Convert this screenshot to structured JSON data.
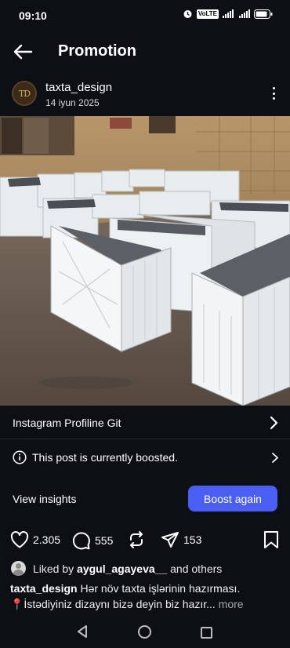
{
  "status_bar": {
    "time": "09:10",
    "volte_badge": "VoLTE",
    "network": "4G",
    "icons": [
      "alarm-icon",
      "volte-icon",
      "signal-icon",
      "signal-4g-icon",
      "battery-icon"
    ]
  },
  "header": {
    "title": "Promotion",
    "back_icon": "arrow-left-icon"
  },
  "post": {
    "username": "taxta_design",
    "date": "14 iyun 2025",
    "avatar_logo": "TD",
    "image_description_icon": "post-photo"
  },
  "profile_link": {
    "label": "Instagram Profiline Git"
  },
  "boost_status": {
    "label": "This post is currently boosted."
  },
  "insights": {
    "label": "View insights",
    "boost_button": "Boost again"
  },
  "actions": {
    "likes": "2.305",
    "comments": "555",
    "shares": "153"
  },
  "liked_by": {
    "prefix": "Liked by",
    "user": "aygul_agayeva__",
    "suffix": "and others"
  },
  "caption": {
    "username": "taxta_design",
    "line1": "Hər növ taxta işlərinin hazırması.",
    "line2": "📍İstədiyiniz dizaynı bizə deyin biz hazır...",
    "more": "more"
  },
  "colors": {
    "background": "#0c1014",
    "accent_button": "#4a5ef2",
    "text": "#ffffff"
  }
}
